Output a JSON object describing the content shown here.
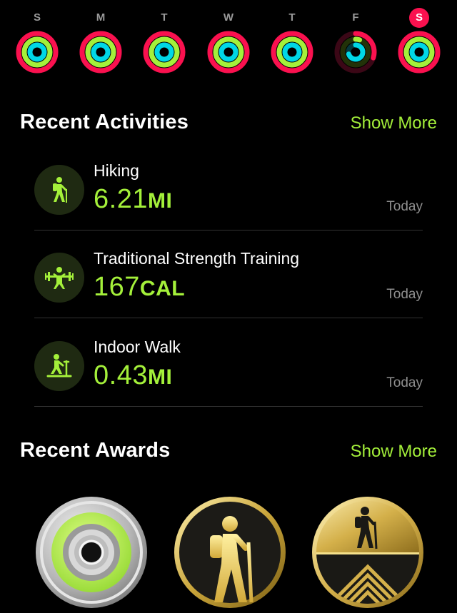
{
  "colors": {
    "move": "#fa114f",
    "exercise": "#a4f03a",
    "stand": "#00d7e6",
    "accent": "#a4f03a"
  },
  "week": [
    {
      "letter": "S",
      "move": 1.0,
      "exercise": 1.0,
      "stand": 1.0,
      "today": false
    },
    {
      "letter": "M",
      "move": 1.0,
      "exercise": 1.0,
      "stand": 1.0,
      "today": false
    },
    {
      "letter": "T",
      "move": 1.0,
      "exercise": 1.0,
      "stand": 1.0,
      "today": false
    },
    {
      "letter": "W",
      "move": 1.0,
      "exercise": 1.0,
      "stand": 1.0,
      "today": false
    },
    {
      "letter": "T",
      "move": 1.0,
      "exercise": 1.0,
      "stand": 1.0,
      "today": false
    },
    {
      "letter": "F",
      "move": 0.3,
      "exercise": 0.05,
      "stand": 0.7,
      "today": false
    },
    {
      "letter": "S",
      "move": 1.0,
      "exercise": 1.0,
      "stand": 1.0,
      "today": true
    }
  ],
  "recent_activities": {
    "title": "Recent Activities",
    "show_more": "Show More",
    "items": [
      {
        "name": "Hiking",
        "value": "6.21",
        "unit": "MI",
        "date": "Today",
        "icon": "hiking-icon"
      },
      {
        "name": "Traditional Strength Training",
        "value": "167",
        "unit": "CAL",
        "date": "Today",
        "icon": "strength-training-icon"
      },
      {
        "name": "Indoor Walk",
        "value": "0.43",
        "unit": "MI",
        "date": "Today",
        "icon": "indoor-walk-icon"
      }
    ]
  },
  "recent_awards": {
    "title": "Recent Awards",
    "show_more": "Show More",
    "items": [
      {
        "name": "exercise-ring-award-badge"
      },
      {
        "name": "hiking-award-badge"
      },
      {
        "name": "hiking-mountain-award-badge"
      }
    ]
  }
}
